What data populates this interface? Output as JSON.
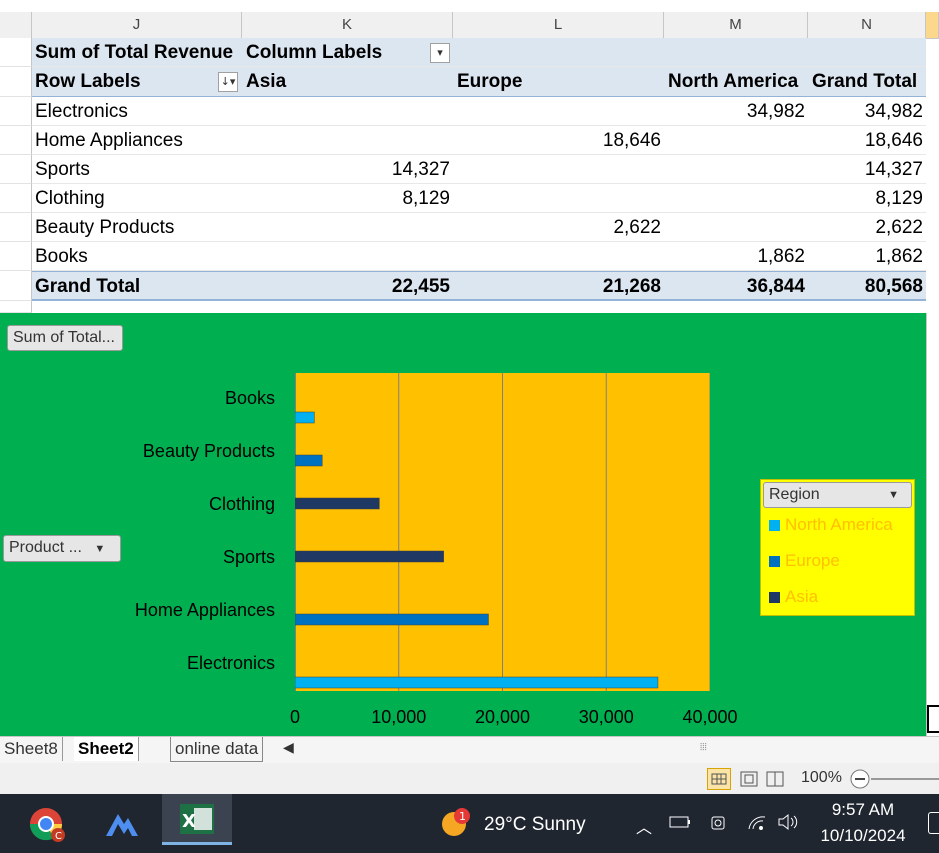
{
  "columns": [
    "J",
    "K",
    "L",
    "M",
    "N"
  ],
  "pivot": {
    "corner_label": "Sum of Total Revenue",
    "col_labels": "Column Labels",
    "row_labels": "Row Labels",
    "regions": [
      "Asia",
      "Europe",
      "North America"
    ],
    "grand_total_label": "Grand Total",
    "rows": [
      {
        "label": "Electronics",
        "asia": "",
        "europe": "",
        "na": "34,982",
        "total": "34,982"
      },
      {
        "label": "Home Appliances",
        "asia": "",
        "europe": "18,646",
        "na": "",
        "total": "18,646"
      },
      {
        "label": "Sports",
        "asia": "14,327",
        "europe": "",
        "na": "",
        "total": "14,327"
      },
      {
        "label": "Clothing",
        "asia": "8,129",
        "europe": "",
        "na": "",
        "total": "8,129"
      },
      {
        "label": "Beauty Products",
        "asia": "",
        "europe": "2,622",
        "na": "",
        "total": "2,622"
      },
      {
        "label": "Books",
        "asia": "",
        "europe": "",
        "na": "1,862",
        "total": "1,862"
      }
    ],
    "grand": {
      "label": "Grand Total",
      "asia": "22,455",
      "europe": "21,268",
      "na": "36,844",
      "total": "80,568"
    }
  },
  "chart": {
    "value_button": "Sum of Total...",
    "axis_button": "Product ...",
    "legend_title": "Region"
  },
  "chart_data": {
    "type": "bar",
    "orientation": "horizontal",
    "categories": [
      "Electronics",
      "Home Appliances",
      "Sports",
      "Clothing",
      "Beauty Products",
      "Books"
    ],
    "series": [
      {
        "name": "North America",
        "color": "#00b0f0",
        "values": [
          34982,
          0,
          0,
          0,
          0,
          1862
        ]
      },
      {
        "name": "Europe",
        "color": "#0070c0",
        "values": [
          0,
          18646,
          0,
          0,
          2622,
          0
        ]
      },
      {
        "name": "Asia",
        "color": "#1f3864",
        "values": [
          0,
          0,
          14327,
          8129,
          0,
          0
        ]
      }
    ],
    "xlim": [
      0,
      40000
    ],
    "x_ticks": [
      "0",
      "10,000",
      "20,000",
      "30,000",
      "40,000"
    ],
    "grid": true,
    "legend_position": "right"
  },
  "sheet_tabs": [
    "Sheet8",
    "Sheet2",
    "online data"
  ],
  "active_tab": "Sheet2",
  "status": {
    "zoom": "100%"
  },
  "taskbar": {
    "weather_temp": "29°C",
    "weather_cond": "Sunny",
    "weather_badge": "1",
    "time": "9:57 AM",
    "date": "10/10/2024"
  }
}
